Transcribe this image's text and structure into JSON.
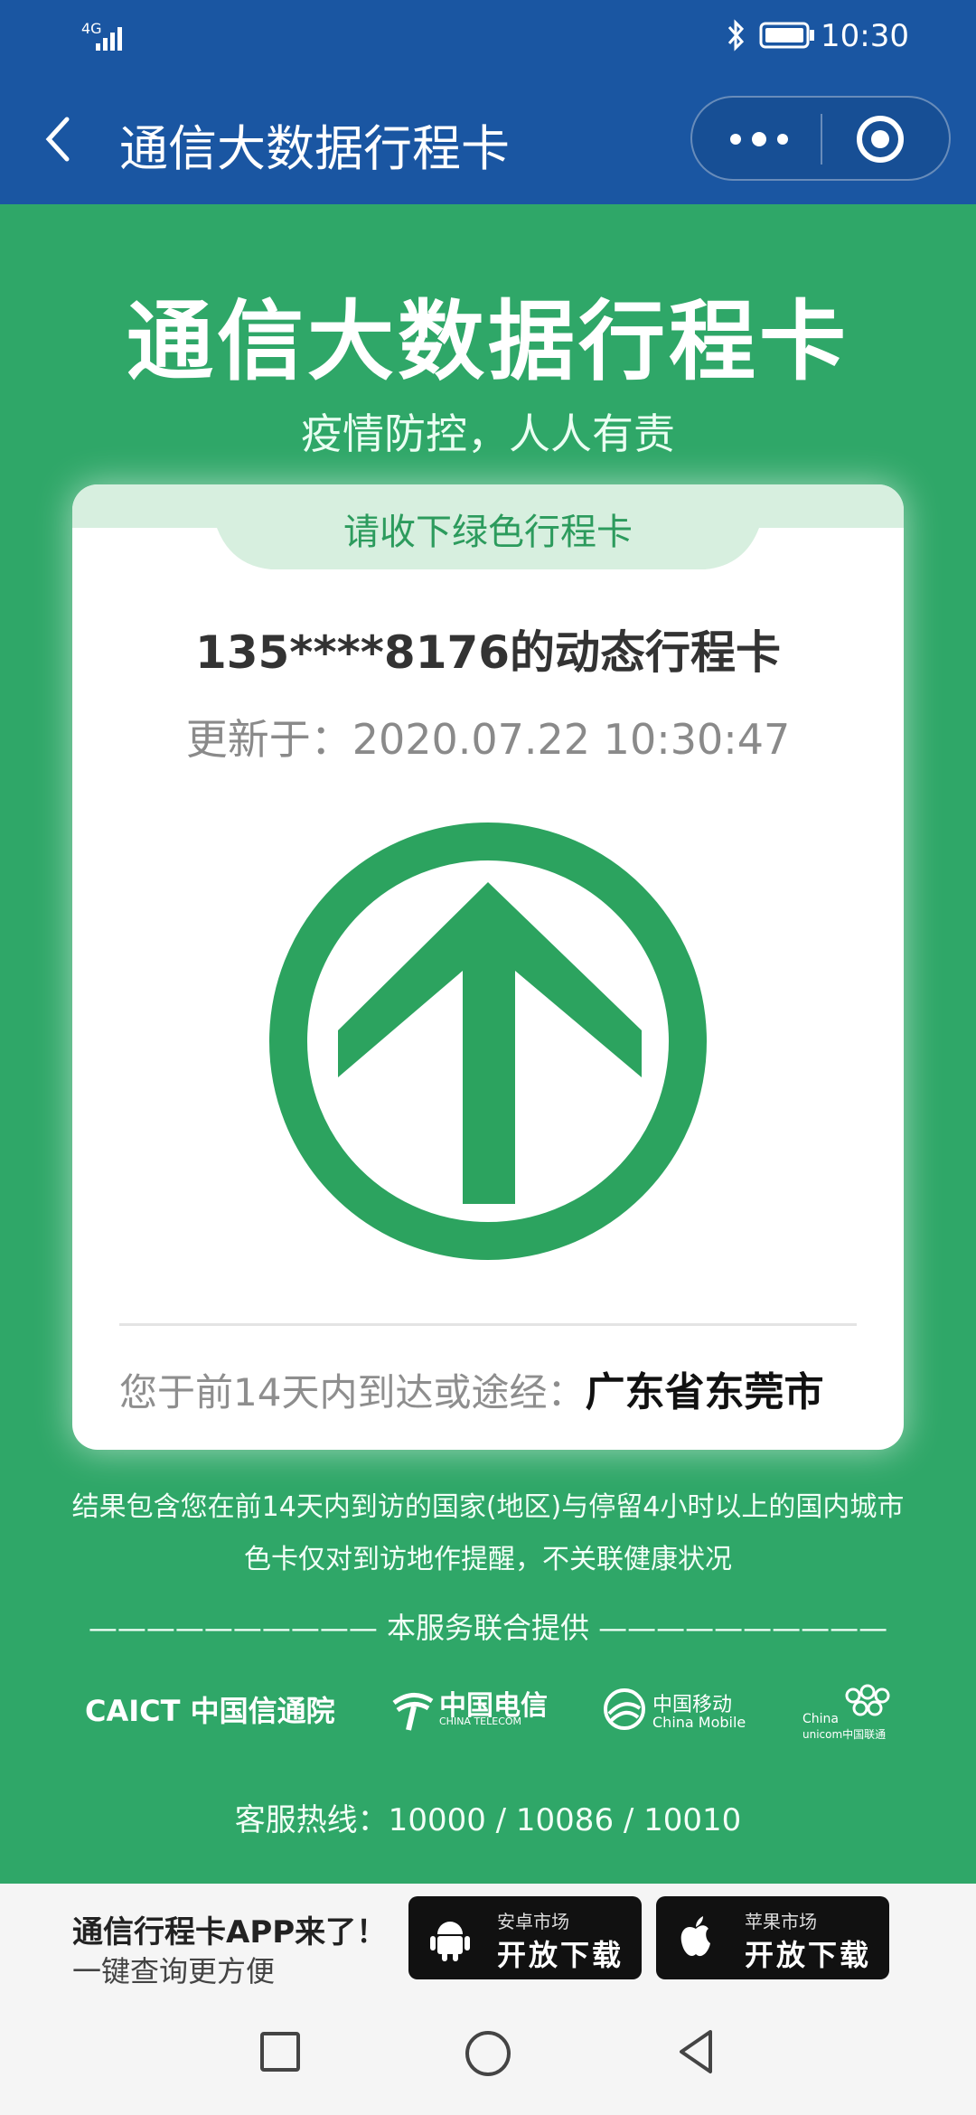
{
  "status_bar": {
    "network": "4G",
    "time": "10:30"
  },
  "nav": {
    "title": "通信大数据行程卡"
  },
  "hero": {
    "title": "通信大数据行程卡",
    "subtitle": "疫情防控，人人有责"
  },
  "card": {
    "tab_label": "请收下绿色行程卡",
    "phone_line": "135****8176的动态行程卡",
    "updated": "更新于：2020.07.22 10:30:47",
    "route_label": "您于前14天内到达或途经：",
    "route_value": "广东省东莞市",
    "status_color": "#2ca35f"
  },
  "notes": {
    "line1": "结果包含您在前14天内到访的国家(地区)与停留4小时以上的国内城市",
    "line2": "色卡仅对到访地作提醒，不关联健康状况",
    "provided_by": "—————————— 本服务联合提供 ——————————"
  },
  "logos": {
    "caict": "CAICT 中国信通院",
    "telecom_cn": "中国电信",
    "telecom_en": "CHINA TELECOM",
    "mobile_cn": "中国移动",
    "mobile_en": "China Mobile",
    "unicom_en1": "China",
    "unicom_en2": "unicom中国联通"
  },
  "hotline": "客服热线：10000 / 10086 / 10010",
  "promo": {
    "title": "通信行程卡APP来了！",
    "subtitle": "一键查询更方便",
    "android": {
      "small": "安卓市场",
      "big": "开放下载"
    },
    "ios": {
      "small": "苹果市场",
      "big": "开放下载"
    }
  },
  "colors": {
    "green": "#2fa768",
    "blue": "#1a56a2"
  }
}
